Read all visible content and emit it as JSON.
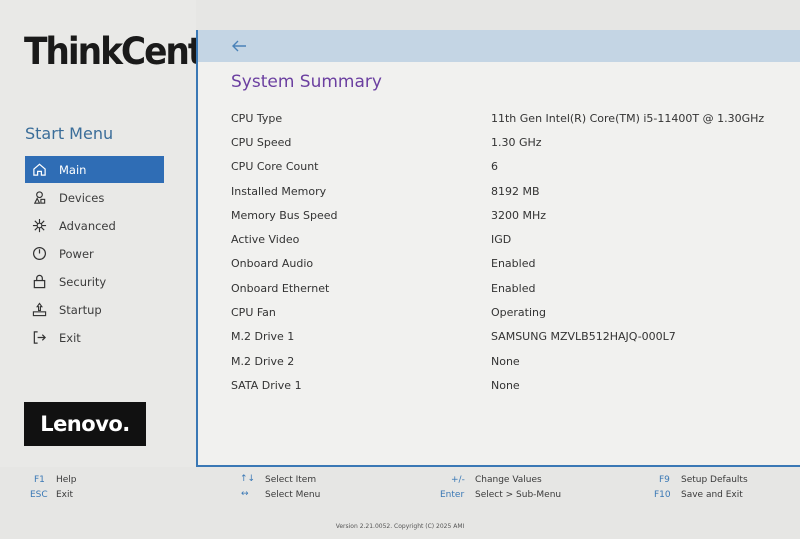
{
  "brand": {
    "name": "ThinkCentre",
    "tm": ".",
    "vendor": "Lenovo."
  },
  "sidebar": {
    "title": "Start Menu",
    "items": [
      {
        "label": "Main",
        "icon": "home-icon",
        "active": true
      },
      {
        "label": "Devices",
        "icon": "devices-icon",
        "active": false
      },
      {
        "label": "Advanced",
        "icon": "advanced-icon",
        "active": false
      },
      {
        "label": "Power",
        "icon": "power-icon",
        "active": false
      },
      {
        "label": "Security",
        "icon": "lock-icon",
        "active": false
      },
      {
        "label": "Startup",
        "icon": "startup-icon",
        "active": false
      },
      {
        "label": "Exit",
        "icon": "exit-icon",
        "active": false
      }
    ]
  },
  "main": {
    "title": "System Summary",
    "rows": [
      {
        "label": "CPU Type",
        "value": "11th Gen Intel(R) Core(TM) i5-11400T @ 1.30GHz"
      },
      {
        "label": "CPU Speed",
        "value": "1.30 GHz"
      },
      {
        "label": "CPU Core Count",
        "value": "6"
      },
      {
        "label": "Installed Memory",
        "value": "8192 MB"
      },
      {
        "label": "Memory Bus Speed",
        "value": "3200 MHz"
      },
      {
        "label": "Active Video",
        "value": "IGD"
      },
      {
        "label": "Onboard Audio",
        "value": "Enabled"
      },
      {
        "label": "Onboard Ethernet",
        "value": "Enabled"
      },
      {
        "label": "CPU Fan",
        "value": "Operating"
      },
      {
        "label": "M.2 Drive 1",
        "value": "SAMSUNG MZVLB512HAJQ-000L7"
      },
      {
        "label": "M.2 Drive 2",
        "value": "None"
      },
      {
        "label": "SATA Drive 1",
        "value": "None"
      }
    ]
  },
  "footer": {
    "hotkeys": [
      {
        "key": "F1",
        "action": "Help"
      },
      {
        "key": "ESC",
        "action": "Exit"
      },
      {
        "key": "↑↓",
        "action": "Select Item"
      },
      {
        "key": "↔",
        "action": "Select Menu"
      },
      {
        "key": "+/-",
        "action": "Change Values"
      },
      {
        "key": "Enter",
        "action": "Select > Sub-Menu"
      },
      {
        "key": "F9",
        "action": "Setup Defaults"
      },
      {
        "key": "F10",
        "action": "Save and Exit"
      }
    ],
    "version": "Version 2.21.0052. Copyright (C) 2025 AMI"
  },
  "colors": {
    "accent": "#2f6db5",
    "title": "#6b3fa0",
    "header_bar": "#c4d5e4"
  }
}
